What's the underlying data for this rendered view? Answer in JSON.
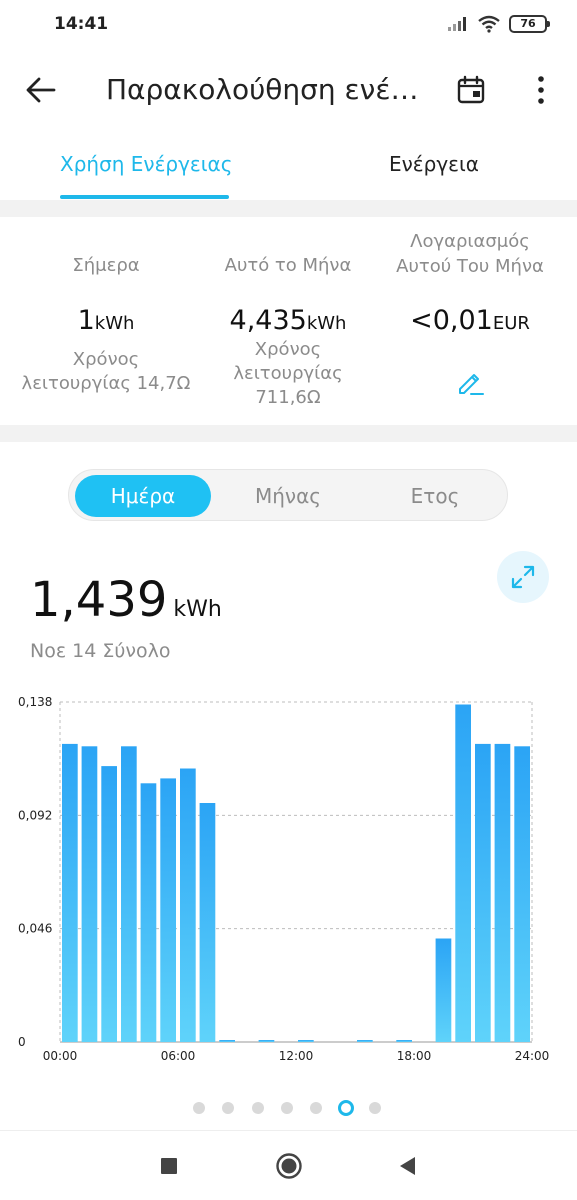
{
  "status_bar": {
    "time": "14:41",
    "battery": "76"
  },
  "header": {
    "title": "Παρακολούθηση ενέρ..."
  },
  "tabs": [
    {
      "label": "Χρήση Ενέργειας",
      "active": true
    },
    {
      "label": "Ενέργεια",
      "active": false
    }
  ],
  "stats": {
    "today": {
      "label": "Σήμερα",
      "value": "1",
      "unit": "kWh",
      "sub": "Χρόνος λειτουργίας 14,7Ω"
    },
    "month": {
      "label": "Αυτό το Μήνα",
      "value": "4,435",
      "unit": "kWh",
      "sub": "Χρόνος λειτουργίας 711,6Ω"
    },
    "bill": {
      "label": "Λογαριασμός Αυτού Του Μήνα",
      "value": "<0,01",
      "unit": "EUR"
    }
  },
  "period_selector": {
    "options": [
      "Ημέρα",
      "Μήνας",
      "Ετος"
    ],
    "selected": "Ημέρα"
  },
  "total": {
    "value": "1,439",
    "unit": "kWh",
    "caption": "Νοε 14 Σύνολο"
  },
  "chart_data": {
    "type": "bar",
    "x_tick_labels": [
      "00:00",
      "06:00",
      "12:00",
      "18:00",
      "24:00"
    ],
    "y_tick_labels": [
      "0,138",
      "0,092",
      "0,046",
      "0"
    ],
    "ylim": [
      0,
      0.138
    ],
    "grid": true,
    "values": [
      0.121,
      0.12,
      0.112,
      0.12,
      0.105,
      0.107,
      0.111,
      0.097,
      0.0005,
      0,
      0.0005,
      0,
      0.0005,
      0,
      0,
      0.0005,
      0,
      0.0005,
      0,
      0.042,
      0.137,
      0.121,
      0.121,
      0.12
    ],
    "colors": {
      "bar_top": "#2ba4f5",
      "bar_bottom": "#5fd3fa",
      "grid": "#bdbdbd"
    }
  },
  "pager": {
    "count": 7,
    "active": 5
  },
  "colors": {
    "accent": "#1eb8ea",
    "segment_active": "#1fc1f3"
  }
}
